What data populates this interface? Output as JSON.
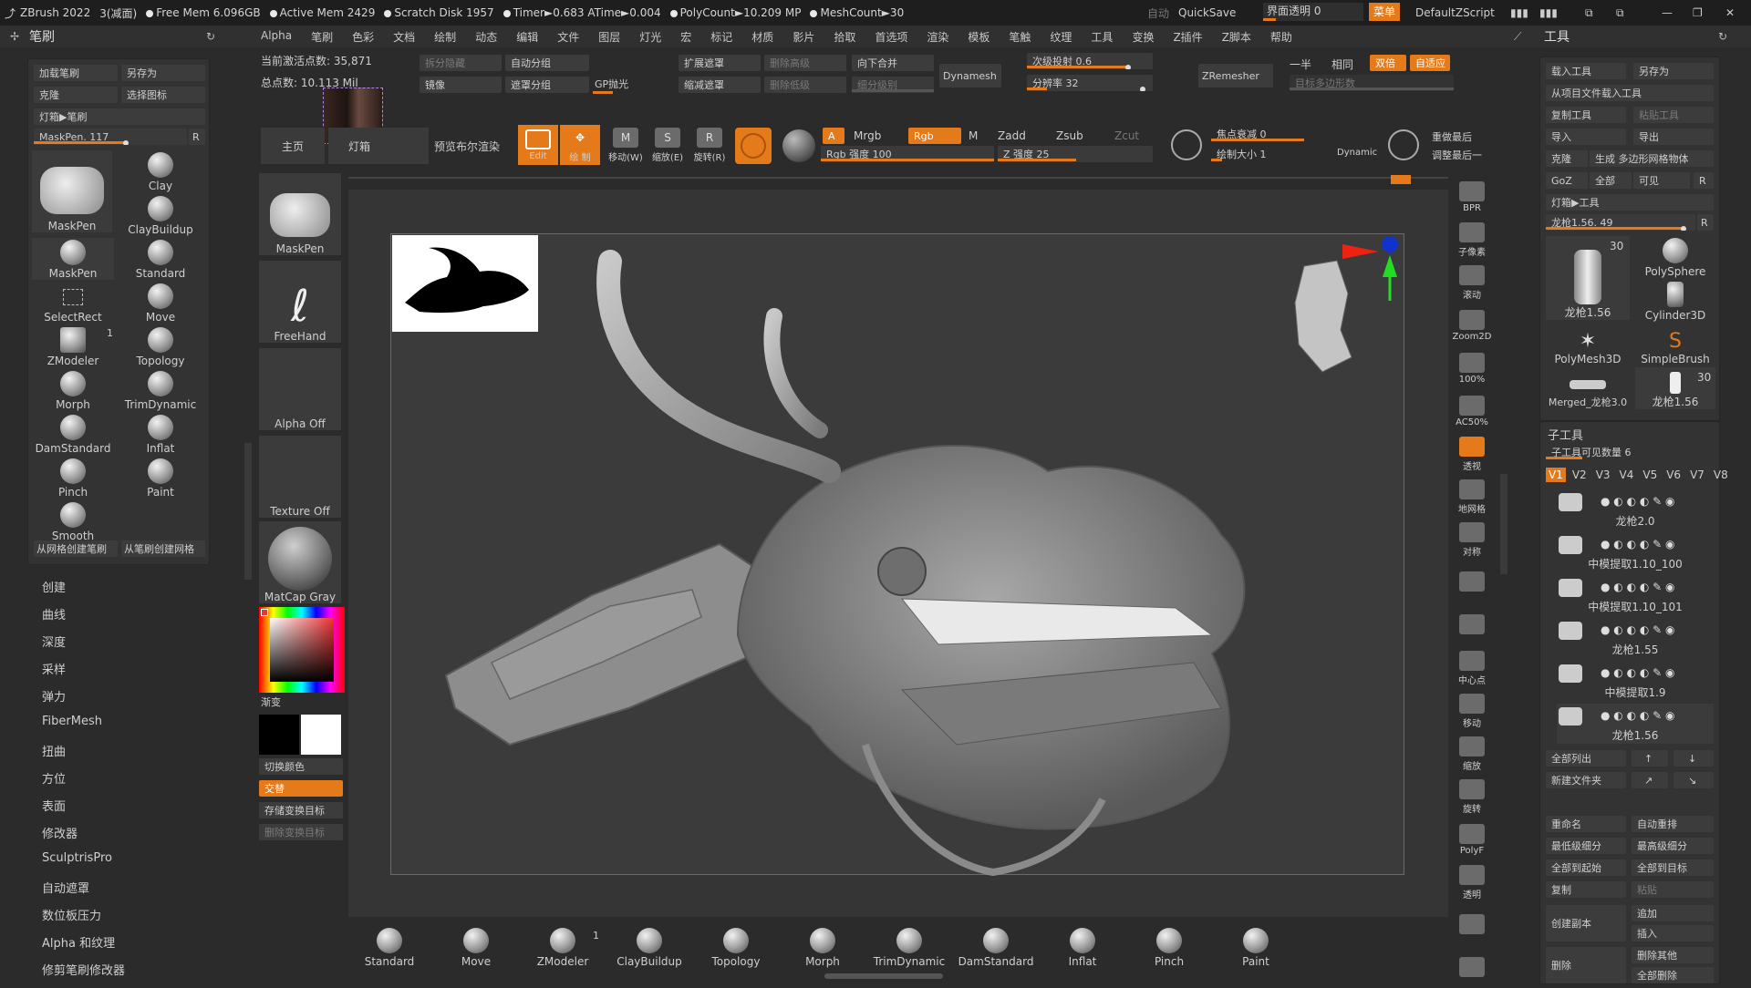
{
  "titlebar": {
    "app": "ZBrush 2022",
    "doc": "3(减面)",
    "free_mem": "Free Mem 6.096GB",
    "active_mem": "Active Mem 2429",
    "scratch": "Scratch Disk 1957",
    "timer": "Timer►0.683 ATime►0.004",
    "polycount": "PolyCount►10.209 MP",
    "meshcount": "MeshCount►30",
    "auto": "自动",
    "quicksave": "QuickSave",
    "transparency": "界面透明 0",
    "menu": "菜单",
    "script": "DefaultZScript"
  },
  "menubar": [
    "Alpha",
    "笔刷",
    "色彩",
    "文档",
    "绘制",
    "动态",
    "编辑",
    "文件",
    "图层",
    "灯光",
    "宏",
    "标记",
    "材质",
    "影片",
    "拾取",
    "首选项",
    "渲染",
    "模板",
    "笔触",
    "纹理",
    "工具",
    "变换",
    "Z插件",
    "Z脚本",
    "帮助"
  ],
  "left_panel": {
    "title": "笔刷",
    "load_brush": "加载笔刷",
    "save_as": "另存为",
    "clone": "克隆",
    "select_icon": "选择图标",
    "lightbox": "灯箱▶笔刷",
    "maskpen_slider": "MaskPen. 117",
    "r": "R",
    "brushes": [
      {
        "label": "MaskPen"
      },
      {
        "label": "Clay"
      },
      {
        "label": "ClayBuildup"
      },
      {
        "label": "MaskPen"
      },
      {
        "label": "Standard"
      },
      {
        "label": "SelectRect"
      },
      {
        "label": "Move"
      },
      {
        "label": "ZModeler"
      },
      {
        "label": "Topology"
      },
      {
        "label": "Morph"
      },
      {
        "label": "TrimDynamic"
      },
      {
        "label": "DamStandard"
      },
      {
        "label": "Inflat"
      },
      {
        "label": "Pinch"
      },
      {
        "label": "Paint"
      },
      {
        "label": "Smooth"
      }
    ],
    "zmodeler_count": "1",
    "from_mesh": "从网格创建笔刷",
    "from_brush": "从笔刷创建网格",
    "menu": [
      "创建",
      "曲线",
      "深度",
      "采样",
      "弹力",
      "FiberMesh",
      "扭曲",
      "方位",
      "表面",
      "修改器",
      "SculptrisPro",
      "自动遮罩",
      "数位板压力",
      "Alpha 和纹理",
      "修剪笔刷修改器"
    ]
  },
  "top_info": {
    "active_points": "当前激活点数: 35,871",
    "total_points": "总点数: 10.113 Mil"
  },
  "top_controls": {
    "split_hidden": "拆分隐藏",
    "auto_group": "自动分组",
    "mirror": "镜像",
    "mask_group": "遮罩分组",
    "gp_polish": "GP抛光",
    "expand_mask": "扩展遮罩",
    "shrink_mask": "缩减遮罩",
    "del_higher": "删除高级",
    "del_lower": "删除低级",
    "merge_down": "向下合并",
    "subdiv_level": "细分级别",
    "dynamesh": "Dynamesh",
    "sub_project": "次级投射 0.6",
    "resolution": "分辨率 32",
    "zremesher": "ZRemesher",
    "half": "一半",
    "same": "相同",
    "double": "双倍",
    "adaptive": "自适应",
    "target_poly": "目标多边形数"
  },
  "shelf": {
    "home": "主页",
    "lightbox_btn": "灯箱",
    "preview_render": "预览布尔渲染",
    "edit": "Edit",
    "draw": "绘 制",
    "move": "移动(W)",
    "scale": "缩放(E)",
    "rotate": "旋转(R)",
    "a": "A",
    "mrgb": "Mrgb",
    "rgb": "Rgb",
    "m": "M",
    "zadd": "Zadd",
    "zsub": "Zsub",
    "zcut": "Zcut",
    "rgb_intensity": "Rgb 强度 100",
    "z_intensity": "Z 强度 25",
    "focal_shift": "焦点衰减 0",
    "draw_size": "绘制大小 1",
    "dynamic": "Dynamic",
    "replay_last": "重做最后",
    "adjust_last": "调整最后一"
  },
  "left_col2": {
    "brush": "MaskPen",
    "stroke": "FreeHand",
    "alpha": "Alpha Off",
    "texture": "Texture Off",
    "material": "MatCap Gray",
    "gradient": "渐变",
    "switch_color": "切换颜色",
    "alternate": "交替",
    "store_morph": "存储变换目标",
    "del_morph": "删除变换目标"
  },
  "right_nav": [
    "BPR",
    "子像素",
    "滚动",
    "Zoom2D",
    "100%",
    "AC50%",
    "透视",
    "地网格",
    "对称",
    "",
    "",
    "中心点",
    "移动",
    "缩放",
    "旋转",
    "PolyF",
    "透明",
    "",
    ""
  ],
  "right_panel": {
    "title": "工具",
    "load_tool": "载入工具",
    "save_as": "另存为",
    "load_from_project": "从项目文件载入工具",
    "copy_tool": "复制工具",
    "paste_tool": "粘贴工具",
    "import": "导入",
    "export": "导出",
    "clone": "克隆",
    "gen_poly": "生成 多边形网格物体",
    "goz": "GoZ",
    "all": "全部",
    "visible": "可见",
    "r": "R",
    "lightbox": "灯箱▶工具",
    "gun_slider": "龙枪1.56. 49",
    "tools": [
      {
        "label": "龙枪1.56",
        "count": "30"
      },
      {
        "label": "PolySphere"
      },
      {
        "label": "Cylinder3D"
      },
      {
        "label": "PolyMesh3D"
      },
      {
        "label": "SimpleBrush"
      },
      {
        "label": "Merged_龙枪3.0"
      },
      {
        "label": "龙枪1.56",
        "count": "30"
      }
    ],
    "subtool_title": "子工具",
    "subtool_visible": "子工具可见数量 6",
    "versions": [
      "V1",
      "V2",
      "V3",
      "V4",
      "V5",
      "V6",
      "V7",
      "V8"
    ],
    "subtools": [
      "龙枪2.0",
      "中模提取1.10_100",
      "中模提取1.10_101",
      "龙枪1.55",
      "中模提取1.9",
      "龙枪1.56"
    ],
    "list_all": "全部列出",
    "new_folder": "新建文件夹",
    "rename": "重命名",
    "auto_reorder": "自动重排",
    "lowest_sub": "最低级细分",
    "highest_sub": "最高级细分",
    "all_to_start": "全部到起始",
    "all_to_target": "全部到目标",
    "duplicate": "复制",
    "paste": "粘贴",
    "create_copy": "创建副本",
    "add": "追加",
    "insert": "插入",
    "delete": "删除",
    "delete_other": "删除其他",
    "delete_all": "全部删除"
  },
  "bottom_brushes": [
    "Standard",
    "Move",
    "ZModeler",
    "ClayBuildup",
    "Topology",
    "Morph",
    "TrimDynamic",
    "DamStandard",
    "Inflat",
    "Pinch",
    "Paint"
  ],
  "bottom_zmodeler_count": "1",
  "colors": {
    "accent": "#e57a1a",
    "panel": "#333333",
    "canvas": "#3b3b3b",
    "bg": "#2b2b2b"
  }
}
